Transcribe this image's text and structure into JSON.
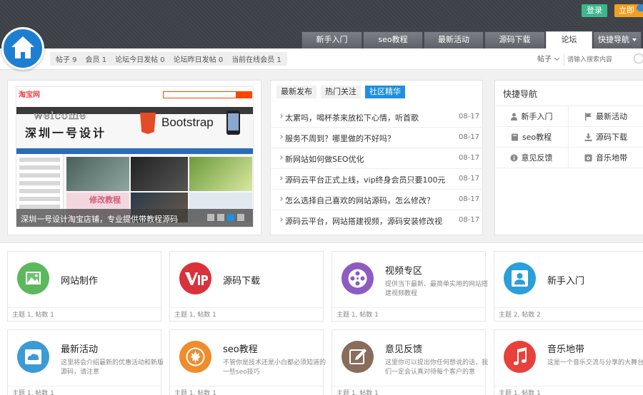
{
  "header": {
    "login_label": "登录",
    "register_label": "立即",
    "nav_tabs": [
      {
        "label": "新手入门",
        "active": false
      },
      {
        "label": "seo教程",
        "active": false
      },
      {
        "label": "最新活动",
        "active": false
      },
      {
        "label": "源码下载",
        "active": false
      },
      {
        "label": "论坛",
        "active": true
      },
      {
        "label": "快捷导航",
        "active": false
      }
    ]
  },
  "stats": {
    "posts": "帖子 9",
    "members": "会员 1",
    "today": "论坛今日发帖 0",
    "yesterday": "论坛昨日发帖 0",
    "online": "当前在线会员 1"
  },
  "search": {
    "type_label": "帖子",
    "placeholder": "请输入搜索内容"
  },
  "slider": {
    "mock_logo": "淘宝网",
    "welcome": "welcome",
    "title": "深圳一号设计",
    "bootstrap": "Bootstrap",
    "badge": "修改教程",
    "caption": "深圳一号设计淘宝店铺，专业提供带教程源码"
  },
  "news": {
    "tabs": [
      {
        "label": "最新发布",
        "active": false
      },
      {
        "label": "热门关注",
        "active": false
      },
      {
        "label": "社区精华",
        "active": true
      }
    ],
    "items": [
      {
        "title": "太累吗，喝杯茶来放松下心情，听首歌",
        "date": "08-17"
      },
      {
        "title": "服务不周到？哪里做的不好吗？",
        "date": "08-17"
      },
      {
        "title": "新网站如何做SEO优化",
        "date": "08-17"
      },
      {
        "title": "源码云平台正式上线，vip终身会员只要100元",
        "date": "08-17"
      },
      {
        "title": "怎么选择自己喜欢的网站源码，怎么修改？",
        "date": "08-17"
      },
      {
        "title": "源码云平台，网站搭建视频，源码安装修改视",
        "date": "08-17"
      }
    ]
  },
  "quicknav": {
    "title": "快捷导航",
    "items": [
      {
        "label": "新手入门",
        "icon": "user-icon"
      },
      {
        "label": "最新活动",
        "icon": "flag-icon"
      },
      {
        "label": "seo教程",
        "icon": "book-icon"
      },
      {
        "label": "源码下载",
        "icon": "download-icon"
      },
      {
        "label": "意见反馈",
        "icon": "info-icon"
      },
      {
        "label": "音乐地带",
        "icon": "music-icon"
      }
    ]
  },
  "forums": [
    {
      "name": "网站制作",
      "desc": "",
      "stats": "主题 1, 帖数 1",
      "color": "#5cb85c",
      "icon": "picture-icon"
    },
    {
      "name": "源码下载",
      "desc": "",
      "stats": "主题 1, 帖数 1",
      "color": "#d9323a",
      "icon": "vip-icon"
    },
    {
      "name": "视频专区",
      "desc": "提供当下最新、最简单实用的网站搭建视频教程",
      "stats": "主题 1, 帖数 1",
      "color": "#8d5bc2",
      "icon": "film-icon"
    },
    {
      "name": "新手入门",
      "desc": "",
      "stats": "主题 2, 帖数 2",
      "color": "#2a9fd8",
      "icon": "person-icon"
    },
    {
      "name": "最新活动",
      "desc": "这里将会介绍最新的优惠活动和新版源码，请注意",
      "stats": "主题 1, 帖数 1",
      "color": "#3c9ad6",
      "icon": "cloud-icon"
    },
    {
      "name": "seo教程",
      "desc": "不管你是技术还是小白都必须知道的一些seo技巧",
      "stats": "主题 1, 帖数 1",
      "color": "#f08c2a",
      "icon": "leaf-icon"
    },
    {
      "name": "意见反馈",
      "desc": "这里你可以提出你任何想说的话，我们一定会认真对待每个客户的意",
      "stats": "主题 1, 帖数 1",
      "color": "#8a6c5c",
      "icon": "edit-icon"
    },
    {
      "name": "音乐地带",
      "desc": "这是一个音乐交流与分享的大舞台",
      "stats": "主题 1, 帖数 1",
      "color": "#e8403a",
      "icon": "music-note-icon"
    }
  ]
}
